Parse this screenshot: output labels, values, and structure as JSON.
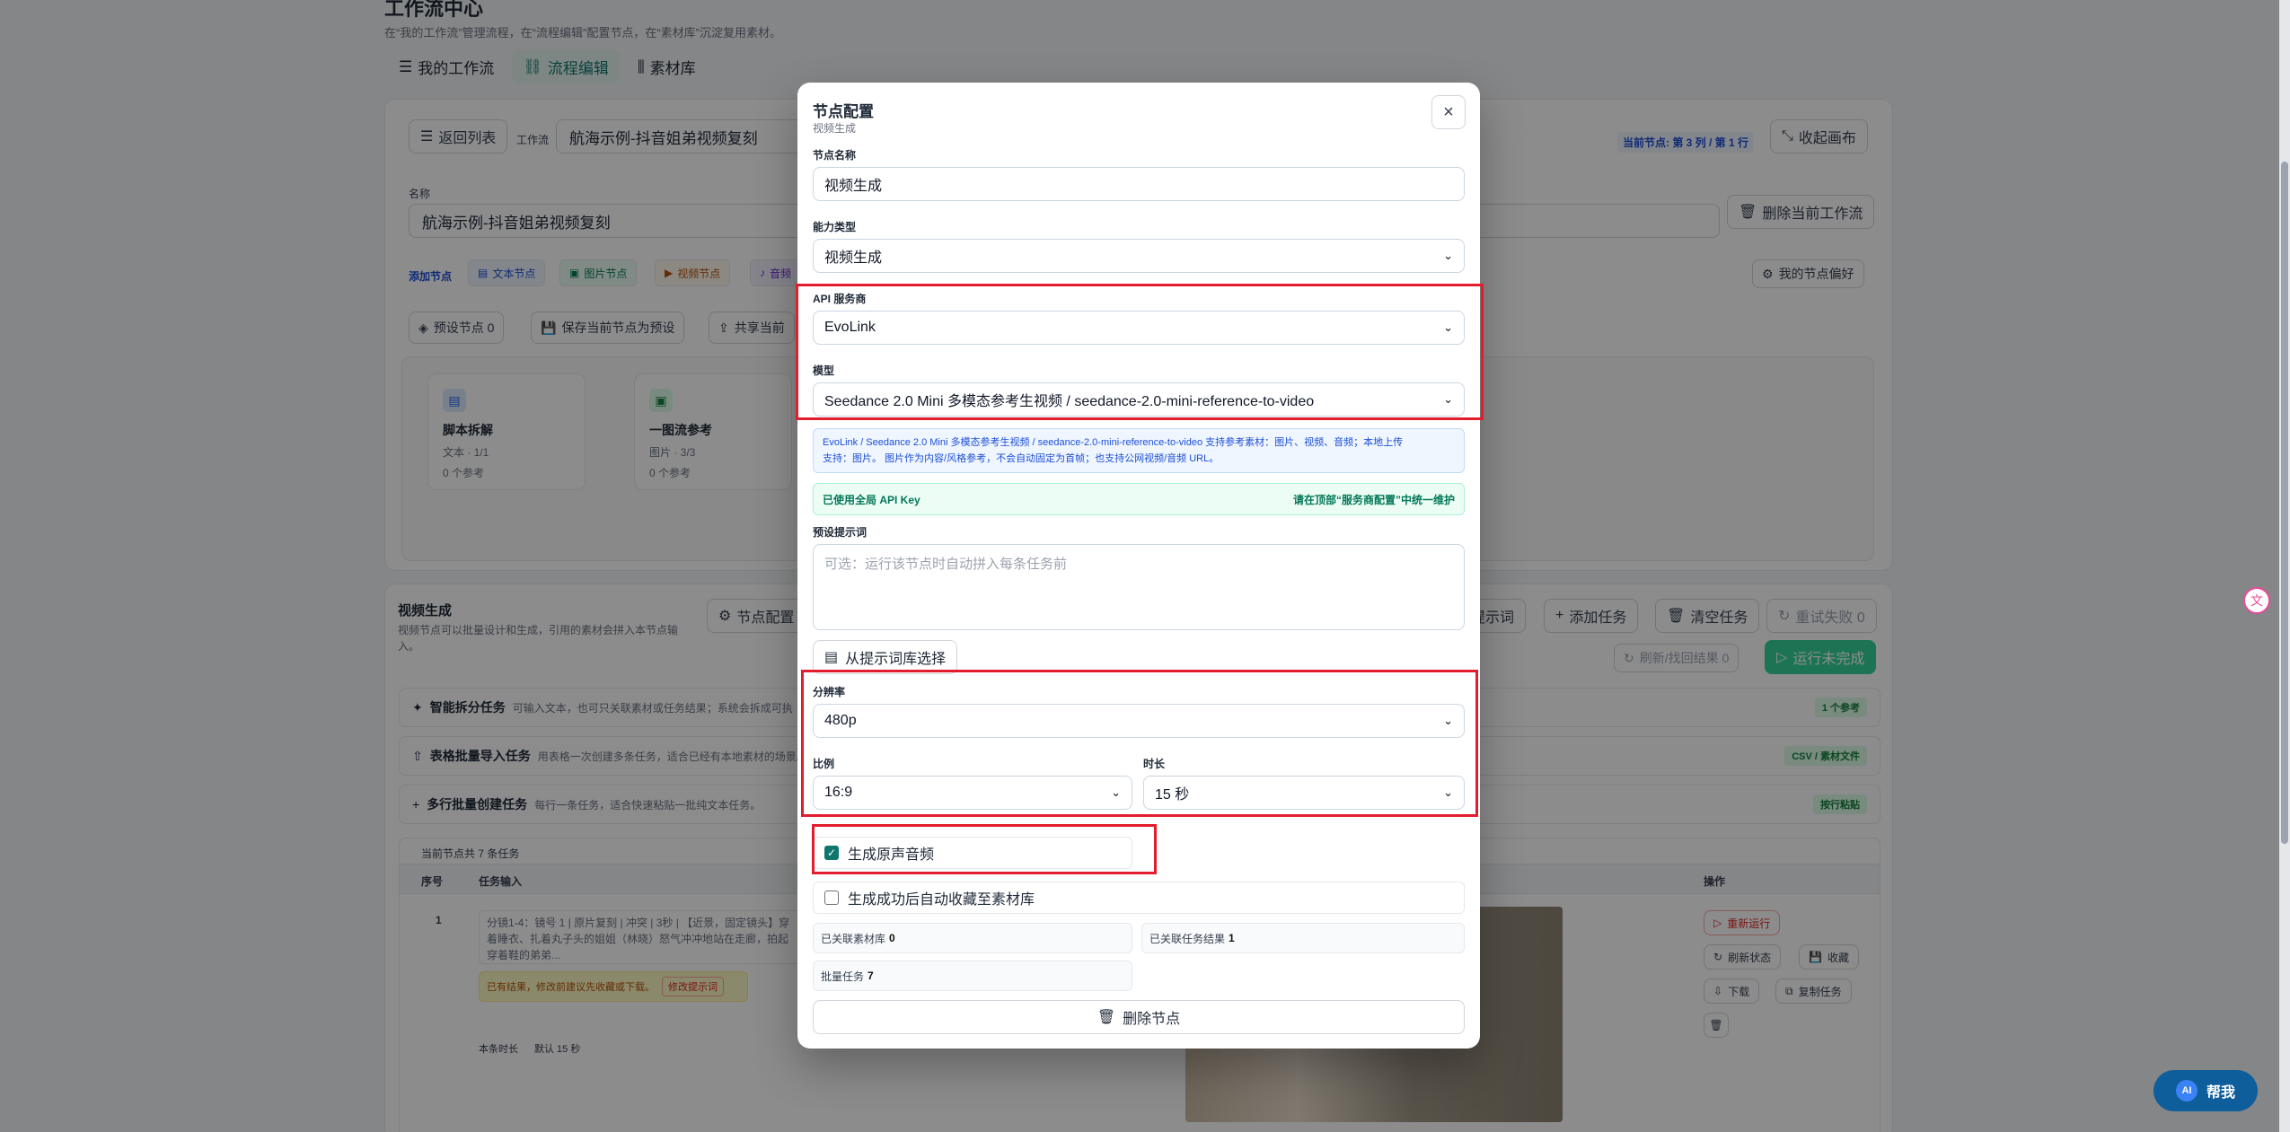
{
  "page": {
    "title": "工作流中心",
    "subtitle": "在“我的工作流”管理流程，在“流程编辑”配置节点，在“素材库”沉淀复用素材。"
  },
  "tabs": [
    "我的工作流",
    "流程编辑",
    "素材库"
  ],
  "editor": {
    "back_label": "返回列表",
    "workflow_label": "工作流",
    "workflow_value": "航海示例-抖音姐弟视频复刻",
    "current_node": "当前节点: 第 3 列 / 第 1 行",
    "collapse_label": "收起画布",
    "name_label": "名称",
    "name_value": "航海示例-抖音姐弟视频复刻",
    "delete_workflow": "删除当前工作流",
    "add_node": "添加节点",
    "node_types": [
      "文本节点",
      "图片节点",
      "视频节点",
      "音频"
    ],
    "preferences": "我的节点偏好",
    "preset_nodes": "预设节点 0",
    "save_preset": "保存当前节点为预设",
    "share_current": "共享当前"
  },
  "canvas_nodes": [
    {
      "title": "脚本拆解",
      "meta": "文本 · 1/1",
      "refs": "0 个参考"
    },
    {
      "title": "一图流参考",
      "meta": "图片 · 3/3",
      "refs": "0 个参考"
    }
  ],
  "video_section": {
    "title": "视频生成",
    "desc": "视频节点可以批量设计和生成，引用的素材会拼入本节点输入。",
    "node_config": "节点配置",
    "prompt_btn": "提示词",
    "add_task": "添加任务",
    "clear_tasks": "清空任务",
    "retry_failed": "重试失败 0",
    "refresh_results": "刷新/找回结果 0",
    "run_unfinished": "运行未完成",
    "rows": [
      {
        "title": "智能拆分任务",
        "desc": "可输入文本，也可只关联素材或任务结果；系统会拆成可执",
        "tag": "1 个参考"
      },
      {
        "title": "表格批量导入任务",
        "desc": "用表格一次创建多条任务，适合已经有本地素材的场景。",
        "tag": "CSV / 素材文件"
      },
      {
        "title": "多行批量创建任务",
        "desc": "每行一条任务，适合快速粘贴一批纯文本任务。",
        "tag": "按行粘贴"
      }
    ],
    "table_caption": "当前节点共 7 条任务",
    "col_index": "序号",
    "col_input": "任务输入",
    "col_ops": "操作",
    "row_index": "1",
    "row_text": "分镜1-4：镜号 1 | 原片复刻 | 冲突 | 3秒 | 【近景，固定镜头】穿着睡衣、扎着丸子头的姐姐（林晓）怒气冲冲地站在走廊，拍起穿着鞋的弟弟...",
    "row_warn": "已有结果，修改前建议先收藏或下载。",
    "row_edit": "修改提示词",
    "row_duration_label": "本条时长",
    "row_duration_value": "默认 15 秒",
    "ops": [
      "重新运行",
      "刷新状态",
      "收藏",
      "下载",
      "复制任务"
    ]
  },
  "modal": {
    "title": "节点配置",
    "subtitle": "视频生成",
    "close": "×",
    "node_name_label": "节点名称",
    "node_name_value": "视频生成",
    "capability_label": "能力类型",
    "capability_value": "视频生成",
    "provider_label": "API 服务商",
    "provider_value": "EvoLink",
    "model_label": "模型",
    "model_value": "Seedance 2.0 Mini 多模态参考生视频 / seedance-2.0-mini-reference-to-video",
    "info_line1": "EvoLink / Seedance 2.0 Mini 多模态参考生视频 / seedance-2.0-mini-reference-to-video 支持参考素材：图片、视频、音频；本地上传",
    "info_line2": "支持：图片。 图片作为内容/风格参考，不会自动固定为首帧；也支持公网视频/音频 URL。",
    "key_left": "已使用全局 API Key",
    "key_right": "请在顶部“服务商配置”中统一维护",
    "preset_prompt_label": "预设提示词",
    "preset_prompt_placeholder": "可选：运行该节点时自动拼入每条任务前",
    "from_library": "从提示词库选择",
    "resolution_label": "分辨率",
    "resolution_value": "480p",
    "ratio_label": "比例",
    "ratio_value": "16:9",
    "duration_label": "时长",
    "duration_value": "15 秒",
    "gen_audio_label": "生成原声音频",
    "gen_audio_checked": true,
    "auto_collect_label": "生成成功后自动收藏至素材库",
    "auto_collect_checked": false,
    "linked_materials_label": "已关联素材库",
    "linked_materials_value": "0",
    "linked_tasks_label": "已关联任务结果",
    "linked_tasks_value": "1",
    "batch_tasks_label": "批量任务",
    "batch_tasks_value": "7",
    "delete_node": "删除节点"
  },
  "ai_help": {
    "badge": "AI",
    "label": "帮我"
  },
  "colors": {
    "accent": "#0f766e",
    "highlight": "#e11d2e",
    "info": "#1d4ed8",
    "success": "#047857"
  }
}
